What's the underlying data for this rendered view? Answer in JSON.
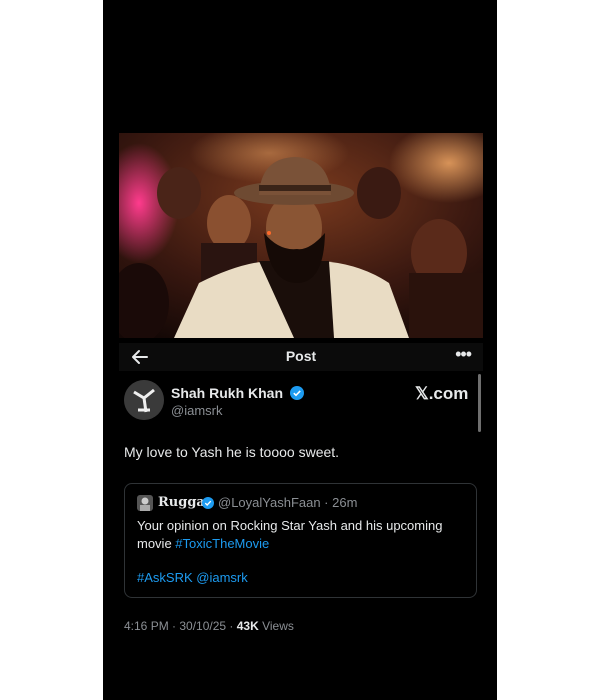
{
  "header": {
    "title": "Post",
    "back_icon": "arrow-left-icon",
    "more_icon": "more-dots-icon",
    "more_label": "•••"
  },
  "photo": {
    "icon": "movie-still-photo"
  },
  "author": {
    "name": "Shah Rukh Khan",
    "handle": "@iamsrk",
    "verified_color": "#1d9bf0"
  },
  "watermark": "𝕏.com",
  "tweet": {
    "text": "My love to Yash he is toooo sweet."
  },
  "quote": {
    "name": "Rugga",
    "handle_time": "@LoyalYashFaan · 26m",
    "text": "Your opinion on Rocking Star Yash and his upcoming movie ",
    "hashtag": "#ToxicTheMovie",
    "tag1": "#AskSRK",
    "tag2": "@iamsrk"
  },
  "meta": {
    "time_date": "4:16 PM · 30/10/25 · ",
    "views_count": "43K",
    "views_label": " Views"
  },
  "colors": {
    "background": "#000000",
    "accent": "#1d9bf0",
    "muted": "#8b8f94",
    "border": "#2f3336"
  }
}
